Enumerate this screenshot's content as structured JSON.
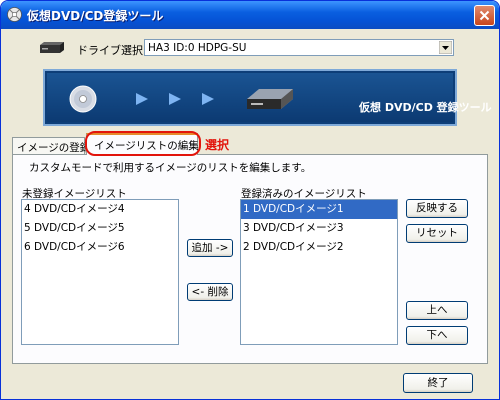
{
  "window": {
    "title": "仮想DVD/CD登録ツール"
  },
  "drive": {
    "label": "ドライブ選択：",
    "selected": "HA3 ID:0 HDPG-SU"
  },
  "banner": {
    "title": "仮想 DVD/CD 登録ツール"
  },
  "tabs": [
    {
      "label": "イメージの登録",
      "active": false
    },
    {
      "label": "イメージリストの編集",
      "active": true
    }
  ],
  "annotation": {
    "text": "選択",
    "color": "#e2140b"
  },
  "description": "カスタムモードで利用するイメージのリストを編集します。",
  "unregistered": {
    "label": "未登録イメージリスト",
    "items": [
      "4 DVD/CDイメージ4",
      "5 DVD/CDイメージ5",
      "6 DVD/CDイメージ6"
    ]
  },
  "registered": {
    "label": "登録済みのイメージリスト",
    "items": [
      "1 DVD/CDイメージ1",
      "3 DVD/CDイメージ3",
      "2 DVD/CDイメージ2"
    ],
    "selected_index": 0
  },
  "buttons": {
    "add": "追加 ->",
    "remove": "<- 削除",
    "apply": "反映する",
    "reset": "リセット",
    "up": "上へ",
    "down": "下へ",
    "exit": "終了"
  },
  "colors": {
    "selection": "#316ac5",
    "banner": "#0d3e78",
    "titlebar": "#0553d6"
  }
}
